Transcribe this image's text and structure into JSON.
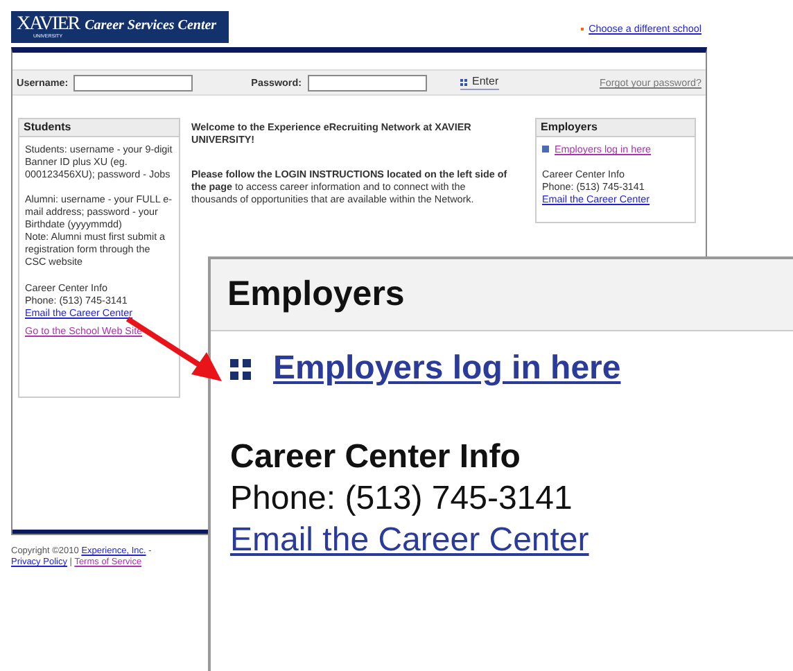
{
  "header": {
    "logo_main": "XAVIER",
    "logo_sub": "UNIVERSITY",
    "title": "Career Services Center",
    "school_link": "Choose a different school"
  },
  "login": {
    "username_label": "Username:",
    "password_label": "Password:",
    "enter_button": "Enter",
    "forgot_link": "Forgot your password?"
  },
  "students": {
    "title": "Students",
    "paragraphs": [
      "Students: username - your 9-digit Banner ID plus XU (eg. 000123456XU); password - Jobs",
      "Alumni: username - your FULL e-mail address; password - your Birthdate (yyyymmdd)",
      "Note: Alumni must first submit a registration form through the CSC website"
    ],
    "info_title": "Career Center Info",
    "phone": "Phone: (513) 745-3141",
    "email_link": "Email the Career Center",
    "school_site_link": "Go to the School Web Site"
  },
  "welcome": {
    "heading": "Welcome to the Experience eRecruiting Network at XAVIER UNIVERSITY!",
    "intro": "**Please follow the LOGIN INSTRUCTIONS located on the left side of the page** to access career information and to connect with the thousands of opportunities that are available within the Network."
  },
  "employers": {
    "title": "Employers",
    "login_link": "Employers log in here",
    "info_title": "Career Center Info",
    "phone": "Phone: (513) 745-3141",
    "email_link": "Email the Career Center"
  },
  "footer": {
    "copyright": "Copyright ©2010",
    "company_link": "Experience, Inc.",
    "dash": "-",
    "privacy_link": "Privacy Policy",
    "divider": "|",
    "terms_link": "Terms of Service"
  },
  "callout": {
    "title": "Employers",
    "login_link": "Employers log in here",
    "info_title": "Career Center Info",
    "phone": "Phone: (513) 745-3141",
    "email_link": "Email the Career Center"
  }
}
